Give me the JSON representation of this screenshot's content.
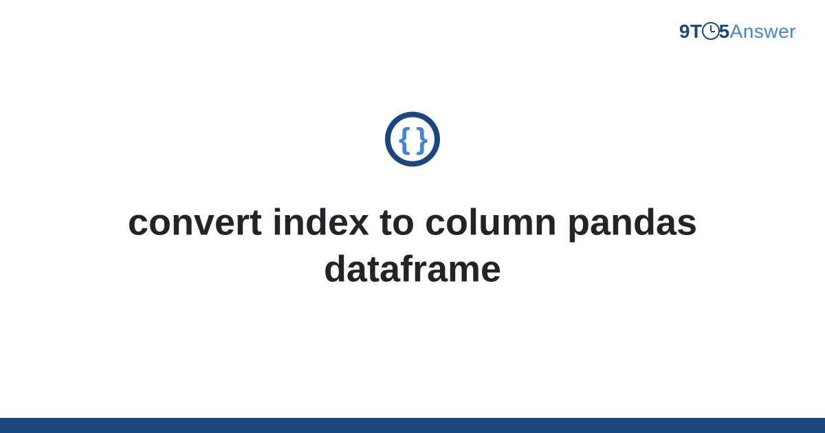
{
  "logo": {
    "part1": "9T",
    "part2": "5",
    "part3": "Answer"
  },
  "icon": {
    "braces": "{ }"
  },
  "title": "convert index to column pandas dataframe"
}
